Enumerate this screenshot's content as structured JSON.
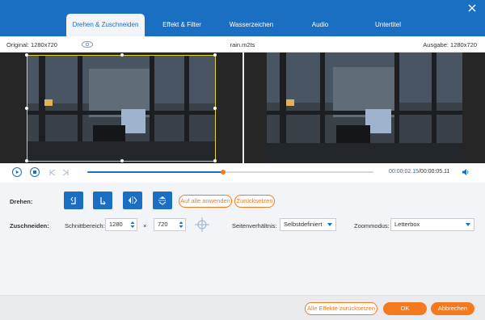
{
  "tabs": [
    {
      "label": "Drehen & Zuschneiden",
      "active": true
    },
    {
      "label": "Effekt & Filter"
    },
    {
      "label": "Wasserzeichen"
    },
    {
      "label": "Audio"
    },
    {
      "label": "Untertitel"
    }
  ],
  "info": {
    "original": "Original: 1280x720",
    "filename": "rain.m2ts",
    "output": "Ausgabe: 1280x720"
  },
  "playback": {
    "current_time": "00:00:02.15",
    "total_time": "/00:00:05.11",
    "progress": 0.475
  },
  "rotate": {
    "label": "Drehen:",
    "apply_all": "Auf alle anwenden",
    "reset": "Zurücksetzen"
  },
  "crop": {
    "label": "Zuschneiden:",
    "area_label": "Schnittbereich:",
    "width": "1280",
    "times": "×",
    "height": "720",
    "aspect_label": "Seitenverhältnis:",
    "aspect_value": "Selbstdefiniert",
    "zoom_label": "Zoommodus:",
    "zoom_value": "Letterbox"
  },
  "footer": {
    "reset_all": "Alle Effekte zurücksetzen",
    "ok": "OK",
    "cancel": "Abbrechen"
  },
  "colors": {
    "accent": "#1b6fc2",
    "orange": "#f47a20"
  }
}
